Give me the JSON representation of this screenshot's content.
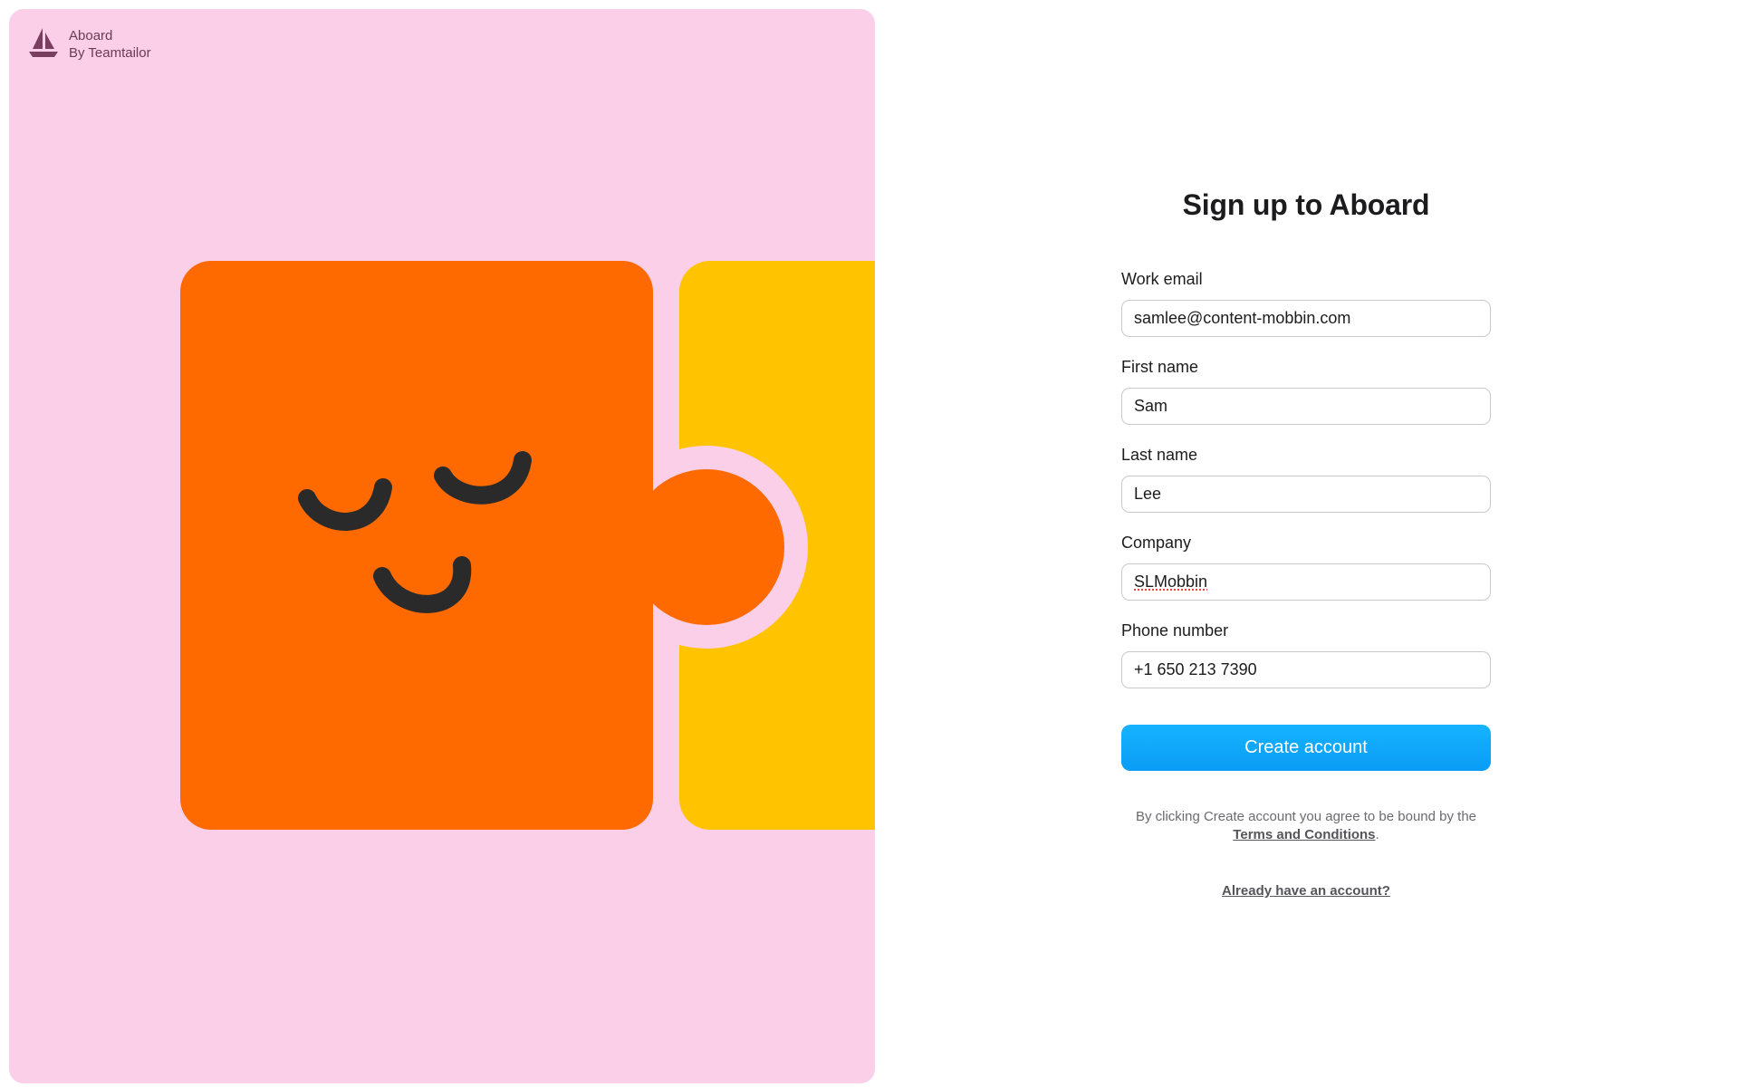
{
  "brand": {
    "name": "Aboard",
    "byline": "By Teamtailor",
    "icon": "sailboat-icon"
  },
  "illustration": {
    "background": "#fbcfe8",
    "puzzle_orange": "#ff6a00",
    "puzzle_yellow": "#ffc300",
    "face_color": "#2a2a2a"
  },
  "form": {
    "title": "Sign up to Aboard",
    "fields": [
      {
        "label": "Work email",
        "value": "samlee@content-mobbin.com"
      },
      {
        "label": "First name",
        "value": "Sam"
      },
      {
        "label": "Last name",
        "value": "Lee"
      },
      {
        "label": "Company",
        "value": "SLMobbin"
      },
      {
        "label": "Phone number",
        "value": "+1 650 213 7390"
      }
    ],
    "submit_label": "Create account",
    "legal_text_before": "By clicking Create account you agree to be bound by the",
    "legal_link": "Terms and Conditions",
    "legal_text_after": ".",
    "signin_link": "Already have an account?",
    "accent": "#0a9cf5"
  }
}
